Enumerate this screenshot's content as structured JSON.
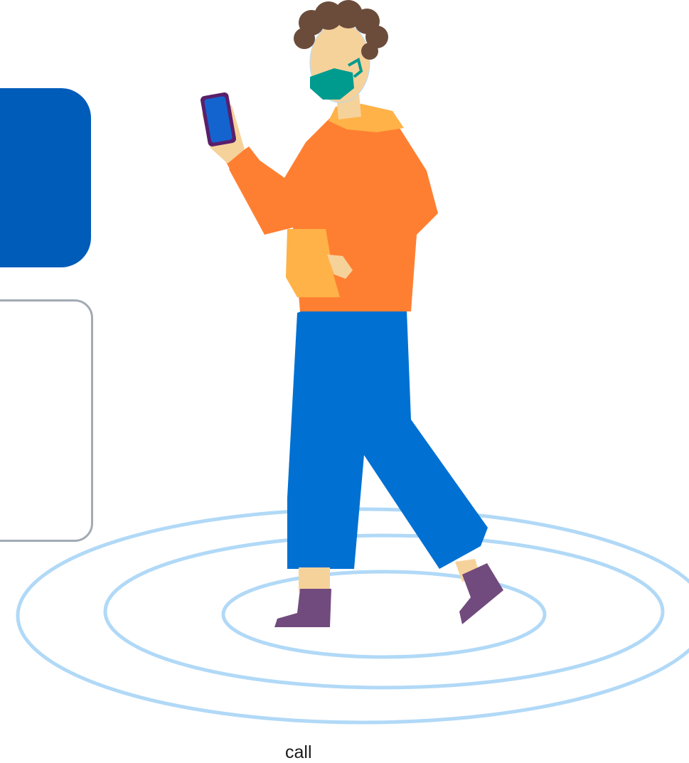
{
  "panel": {
    "text_fragment": "call"
  },
  "illustration": {
    "subject": "person-walking-with-phone-wearing-mask",
    "icon": "signal-rings-icon"
  },
  "colors": {
    "primary_card": "#005cb9",
    "card_border": "#a2aab3",
    "ring": "#b1d9f7",
    "hoodie": "#ff7f32",
    "hood_pocket": "#ffb247",
    "pants": "#0070d2",
    "skin": "#f6d29b",
    "hair": "#6b4c3b",
    "mask": "#009b8f",
    "shoes": "#714b7d",
    "phone_frame": "#5a1f6b",
    "phone_screen": "#1464d0"
  }
}
